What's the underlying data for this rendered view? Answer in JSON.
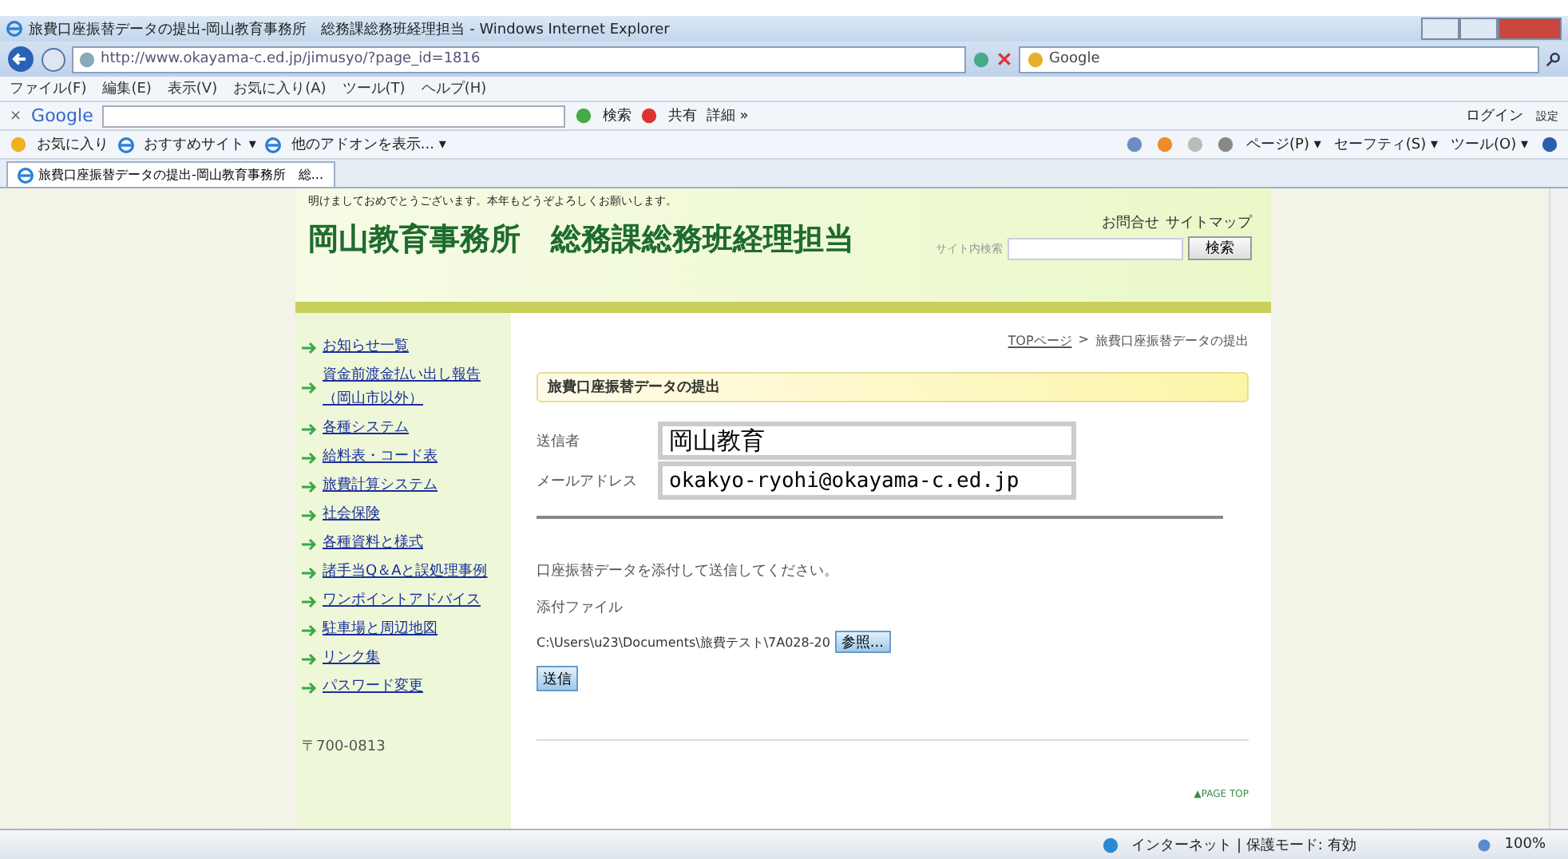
{
  "window": {
    "title": "旅費口座振替データの提出-岡山教育事務所　総務課総務班経理担当 - Windows Internet Explorer"
  },
  "address_bar": {
    "url": "http://www.okayama-c.ed.jp/jimusyo/?page_id=1816",
    "search_placeholder": "Google"
  },
  "menu_bar": [
    "ファイル(F)",
    "編集(E)",
    "表示(V)",
    "お気に入り(A)",
    "ツール(T)",
    "ヘルプ(H)"
  ],
  "google_toolbar": {
    "close": "×",
    "logo": "Google",
    "search_button": "検索",
    "share": "共有",
    "more": "詳細 »",
    "login": "ログイン",
    "settings": "設定"
  },
  "favorites_bar": {
    "favorites": "お気に入り",
    "items": [
      "おすすめサイト ▾",
      "他のアドオンを表示... ▾"
    ],
    "commands": [
      "ページ(P) ▾",
      "セーフティ(S) ▾",
      "ツール(O) ▾"
    ]
  },
  "tabs": [
    {
      "label": "旅費口座振替データの提出-岡山教育事務所　総...",
      "selected": true
    }
  ],
  "page": {
    "greeting": "明けましておめでとうございます。本年もどうぞよろしくお願いします。",
    "site_title": "岡山教育事務所　総務課総務班経理担当",
    "header_links": [
      "お問合せ",
      "サイトマップ"
    ],
    "site_search": {
      "label": "サイト内検索",
      "button": "検索"
    },
    "sidebar": {
      "items": [
        "お知らせ一覧",
        "資金前渡金払い出し報告（岡山市以外）",
        "各種システム",
        "給料表・コード表",
        "旅費計算システム",
        "社会保険",
        "各種資料と様式",
        "諸手当Q＆Aと誤処理事例",
        "ワンポイントアドバイス",
        "駐車場と周辺地図",
        "リンク集",
        "パスワード変更"
      ],
      "postal": "〒700-0813"
    },
    "breadcrumb": {
      "link": "TOPページ",
      "separator": ">",
      "current": "旅費口座振替データの提出"
    },
    "heading": "旅費口座振替データの提出",
    "form": {
      "fields": [
        {
          "label": "送信者",
          "value": "岡山教育"
        },
        {
          "label": "メールアドレス",
          "value": "okakyo-ryohi@okayama-c.ed.jp"
        }
      ],
      "instruction": "口座振替データを添付して送信してください。",
      "attachment_label": "添付ファイル",
      "file_path": "C:\\Users\\u23\\Documents\\旅費テスト\\7A028-20",
      "browse_button": "参照...",
      "submit_button": "送信"
    },
    "page_top": "▲PAGE TOP"
  },
  "status_bar": {
    "zone": "インターネット | 保護モード: 有効",
    "zoom": "100%"
  }
}
